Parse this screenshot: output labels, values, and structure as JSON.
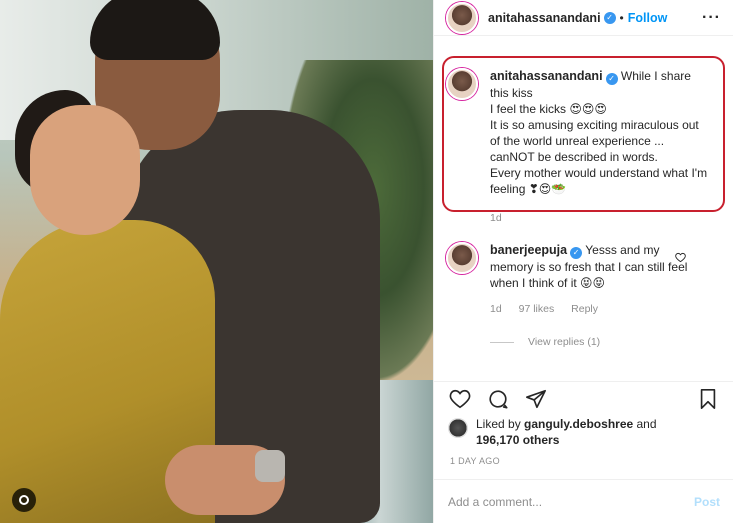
{
  "post": {
    "author": "anitahassanandani",
    "dot": "•",
    "follow_label": "Follow",
    "more_icon": "more-options-icon",
    "more_glyph": "···"
  },
  "caption": {
    "username": "anitahassanandani",
    "text": "While I share this kiss\nI feel the kicks 😍😍😍\nIt is so amusing exciting miraculous out of the world unreal experience ... canNOT be described in words.\nEvery mother would understand what I'm feeling ❣😍🥗",
    "age": "1d"
  },
  "comment": {
    "username": "banerjeepuja",
    "text": "Yesss and my memory is so fresh that I can still feel when I think of it 😝😝",
    "age": "1d",
    "likes": "97 likes",
    "reply_label": "Reply",
    "view_replies": "View replies (1)"
  },
  "likes": {
    "prefix": "Liked by ",
    "user": "ganguly.deboshree",
    "and": " and",
    "others": "196,170 others"
  },
  "timestamp": "1 DAY AGO",
  "add_comment": {
    "placeholder": "Add a comment...",
    "post_label": "Post"
  },
  "colors": {
    "accent": "#0095f6",
    "highlight_box": "#c8202e",
    "post_disabled": "#b2dffc"
  }
}
